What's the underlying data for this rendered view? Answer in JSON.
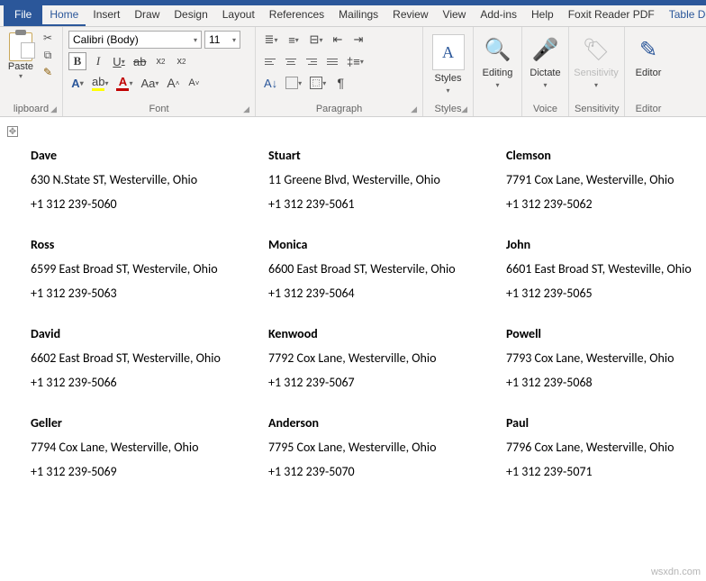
{
  "tabs": [
    "File",
    "Home",
    "Insert",
    "Draw",
    "Design",
    "Layout",
    "References",
    "Mailings",
    "Review",
    "View",
    "Add-ins",
    "Help",
    "Foxit Reader PDF",
    "Table De"
  ],
  "clipboard": {
    "paste": "Paste",
    "label": "lipboard"
  },
  "font": {
    "name": "Calibri (Body)",
    "size": "11",
    "label": "Font"
  },
  "paragraph": {
    "label": "Paragraph"
  },
  "styles": {
    "button": "Styles",
    "label": "Styles"
  },
  "editing": {
    "button": "Editing"
  },
  "voice": {
    "button": "Dictate",
    "label": "Voice"
  },
  "sensitivity": {
    "button": "Sensitivity",
    "label": "Sensitivity"
  },
  "editor": {
    "button": "Editor",
    "label": "Editor"
  },
  "contacts": [
    {
      "name": "Dave",
      "addr": "630 N.State ST, Westerville, Ohio",
      "phone": "+1 312 239-5060"
    },
    {
      "name": "Stuart",
      "addr": "11 Greene Blvd, Westerville, Ohio",
      "phone": "+1 312 239-5061"
    },
    {
      "name": "Clemson",
      "addr": "7791 Cox Lane, Westerville, Ohio",
      "phone": "+1 312 239-5062"
    },
    {
      "name": "Ross",
      "addr": "6599 East Broad ST, Westervile, Ohio",
      "phone": "+1 312 239-5063"
    },
    {
      "name": "Monica",
      "addr": "6600 East Broad ST, Westervile, Ohio",
      "phone": "+1 312 239-5064"
    },
    {
      "name": "John",
      "addr": "6601 East Broad ST, Westeville, Ohio",
      "phone": "+1 312 239-5065"
    },
    {
      "name": "David",
      "addr": "6602 East Broad ST, Westerville, Ohio",
      "phone": "+1 312 239-5066"
    },
    {
      "name": "Kenwood",
      "addr": "7792 Cox Lane, Westerville, Ohio",
      "phone": "+1 312 239-5067"
    },
    {
      "name": "Powell",
      "addr": "7793 Cox Lane, Westerville, Ohio",
      "phone": "+1 312 239-5068"
    },
    {
      "name": "Geller",
      "addr": "7794 Cox Lane, Westerville, Ohio",
      "phone": "+1 312 239-5069"
    },
    {
      "name": "Anderson",
      "addr": "7795 Cox Lane, Westerville, Ohio",
      "phone": "+1 312 239-5070"
    },
    {
      "name": "Paul",
      "addr": "7796 Cox Lane, Westerville, Ohio",
      "phone": "+1 312 239-5071"
    }
  ],
  "watermark": "wsxdn.com"
}
